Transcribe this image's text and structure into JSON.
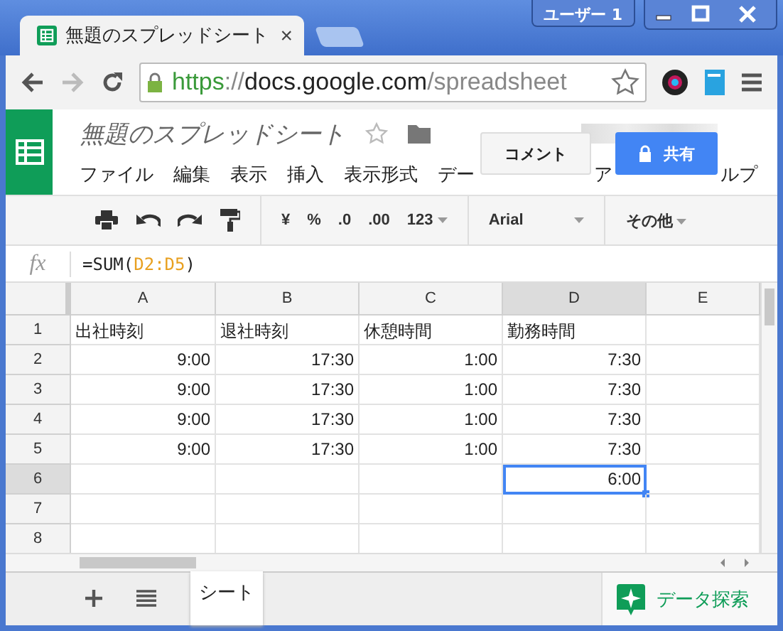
{
  "window": {
    "user_button": "ユーザー 1"
  },
  "tab": {
    "title": "無題のスプレッドシート",
    "close": "×"
  },
  "address_bar": {
    "scheme": "https",
    "separator": "://",
    "host": "docs.google.com",
    "path": "/spreadsheet"
  },
  "doc": {
    "title": "無題のスプレッドシート"
  },
  "menu": [
    "ファイル",
    "編集",
    "表示",
    "挿入",
    "表示形式",
    "デー",
    "ア",
    "ルプ"
  ],
  "comment_button": "コメント",
  "share_button": "共有",
  "toolbar": {
    "currency": "¥",
    "percent": "%",
    "decimal_less": ".0",
    "decimal_more": ".00",
    "number_format": "123",
    "font": "Arial",
    "more": "その他"
  },
  "formula_bar": {
    "fx": "fx",
    "formula_start": "=SUM(",
    "formula_range": "D2:D5",
    "formula_end": ")"
  },
  "columns": [
    {
      "label": "A",
      "selected": false
    },
    {
      "label": "B",
      "selected": false
    },
    {
      "label": "C",
      "selected": false
    },
    {
      "label": "D",
      "selected": true
    },
    {
      "label": "E",
      "selected": false
    }
  ],
  "rows": [
    {
      "label": "1",
      "kind": "text",
      "selected": false,
      "cells": [
        "出社時刻",
        "退社時刻",
        "休憩時間",
        "勤務時間",
        ""
      ]
    },
    {
      "label": "2",
      "kind": "number",
      "selected": false,
      "cells": [
        "9:00",
        "17:30",
        "1:00",
        "7:30",
        ""
      ]
    },
    {
      "label": "3",
      "kind": "number",
      "selected": false,
      "cells": [
        "9:00",
        "17:30",
        "1:00",
        "7:30",
        ""
      ]
    },
    {
      "label": "4",
      "kind": "number",
      "selected": false,
      "cells": [
        "9:00",
        "17:30",
        "1:00",
        "7:30",
        ""
      ]
    },
    {
      "label": "5",
      "kind": "number",
      "selected": false,
      "cells": [
        "9:00",
        "17:30",
        "1:00",
        "7:30",
        ""
      ]
    },
    {
      "label": "6",
      "kind": "number",
      "selected": true,
      "cells": [
        "",
        "",
        "",
        "6:00",
        ""
      ]
    },
    {
      "label": "7",
      "kind": "number",
      "selected": false,
      "cells": [
        "",
        "",
        "",
        "",
        ""
      ]
    },
    {
      "label": "8",
      "kind": "number",
      "selected": false,
      "cells": [
        "",
        "",
        "",
        "",
        ""
      ]
    }
  ],
  "sheet_tabs": [
    {
      "label": "シート",
      "selected": true
    }
  ],
  "explore_button": "データ探索"
}
